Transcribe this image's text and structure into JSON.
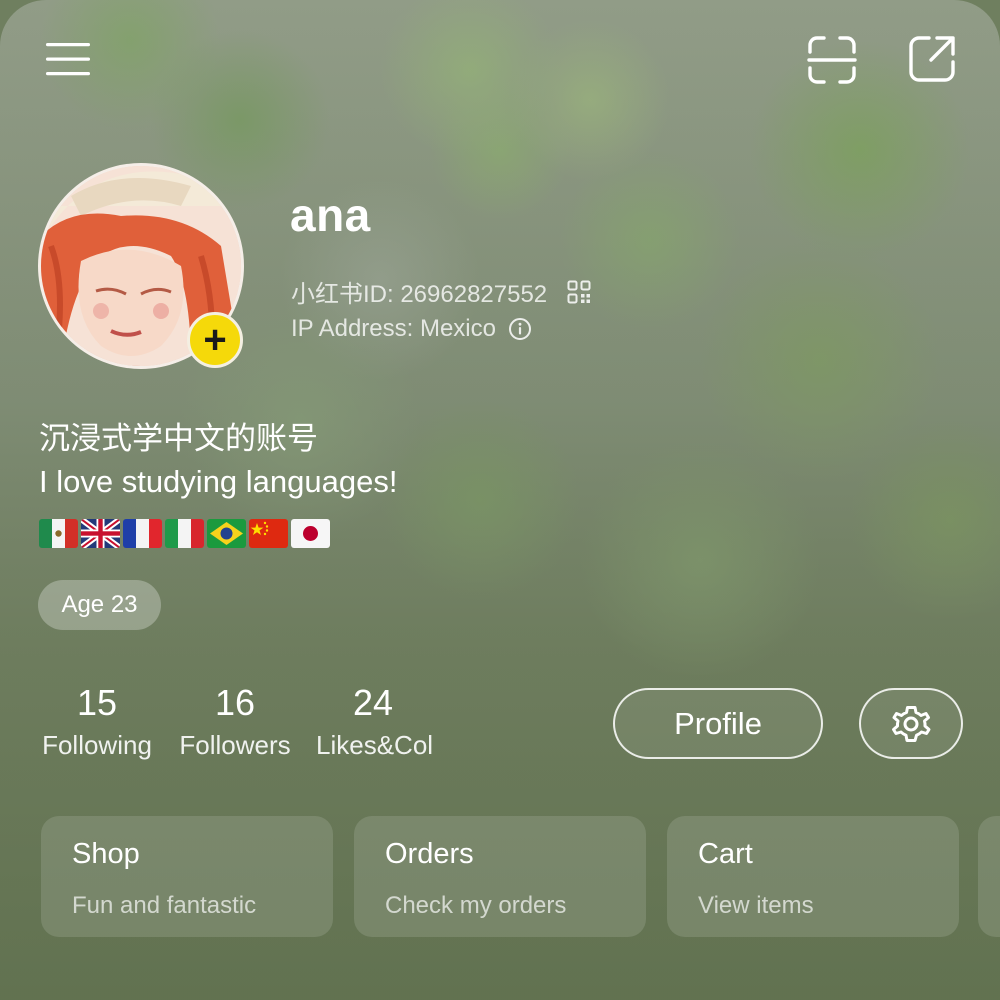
{
  "top_bar": {
    "menu_icon": "hamburger-menu-icon",
    "scan_icon": "scan-icon",
    "share_icon": "share-external-icon"
  },
  "profile": {
    "username": "ana",
    "id_label": "小红书ID: 26962827552",
    "qr_icon": "qr-code-icon",
    "ip_label": "IP Address: Mexico",
    "info_icon": "info-icon",
    "add_badge": "+",
    "bio_line_1": "沉浸式学中文的账号",
    "bio_line_2": "I love studying languages!",
    "flags": [
      "Mexico",
      "United Kingdom",
      "France",
      "Italy",
      "Brazil",
      "China",
      "Japan"
    ],
    "age_tag": "Age 23"
  },
  "stats": [
    {
      "value": "15",
      "label": "Following"
    },
    {
      "value": "16",
      "label": "Followers"
    },
    {
      "value": "24",
      "label": "Likes&Col"
    }
  ],
  "actions": {
    "profile_label": "Profile",
    "settings_icon": "gear-icon"
  },
  "cards": [
    {
      "title": "Shop",
      "subtitle": "Fun and fantastic"
    },
    {
      "title": "Orders",
      "subtitle": "Check my orders"
    },
    {
      "title": "Cart",
      "subtitle": "View items"
    }
  ],
  "colors": {
    "badge_yellow": "#f5d90a",
    "background_green": "#8f9d84"
  }
}
